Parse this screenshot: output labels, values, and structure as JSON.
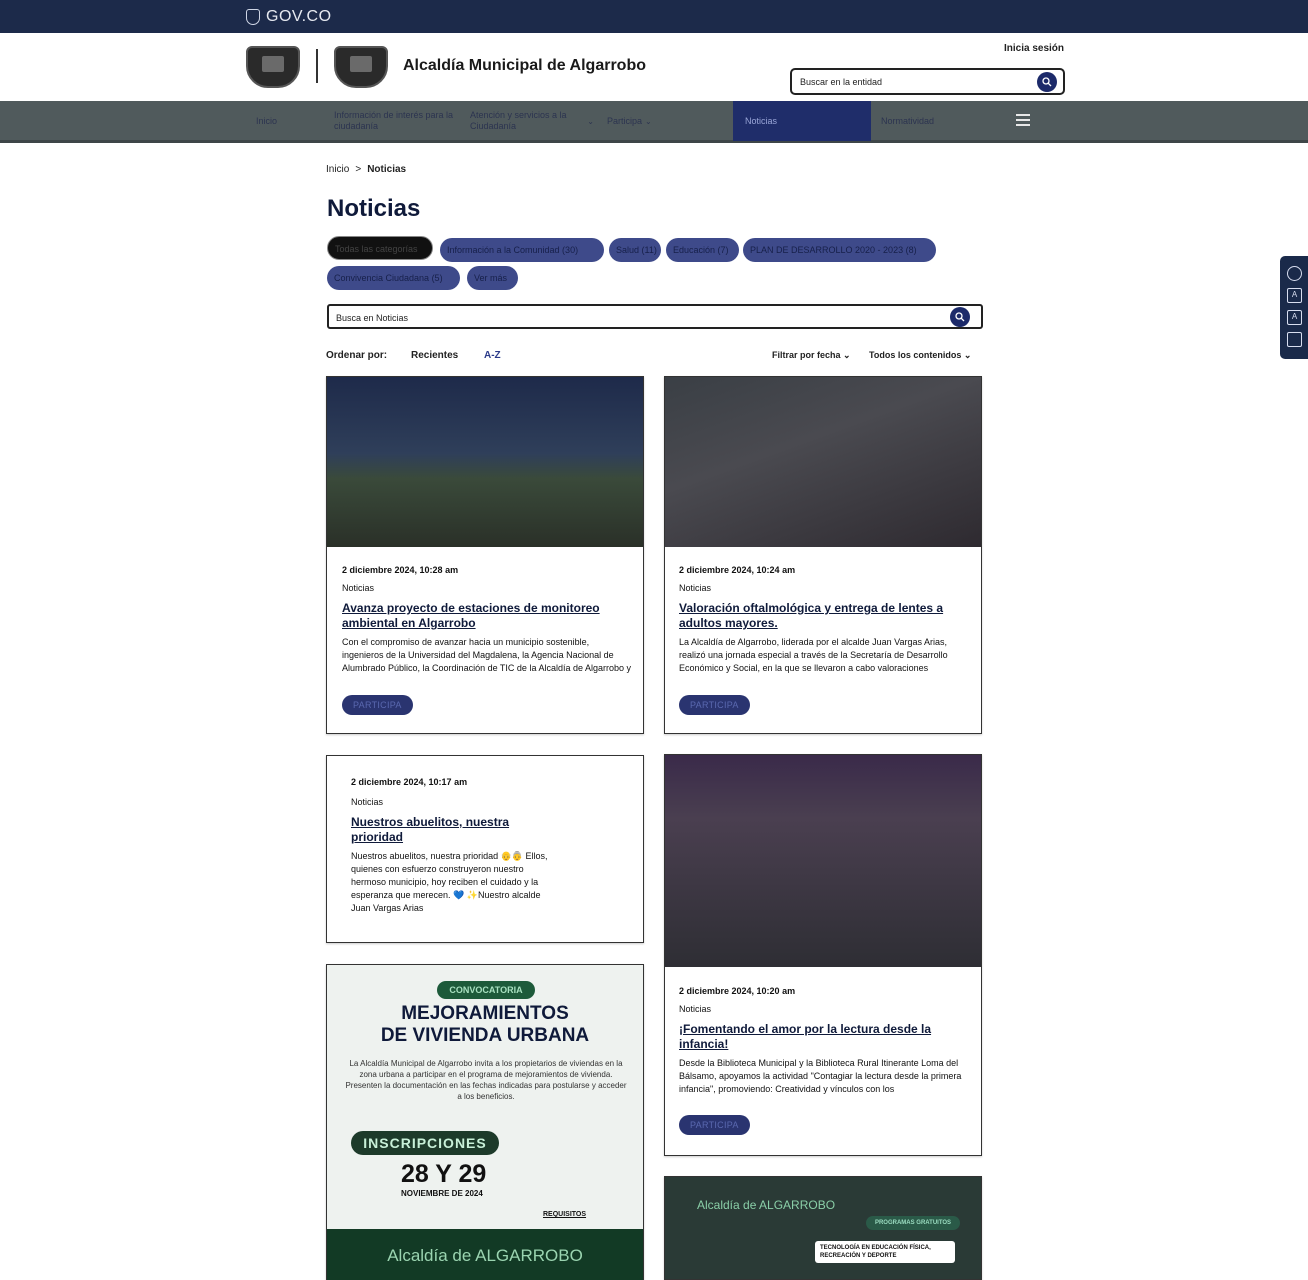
{
  "gov_bar": {
    "label": "GOV.CO"
  },
  "header": {
    "site_name": "Alcaldía Municipal de Algarrobo",
    "login": "Inicia sesión",
    "search_placeholder": "Buscar en la entidad"
  },
  "nav": {
    "items": [
      {
        "label": "Inicio"
      },
      {
        "label": "Información de interés para la ciudadanía"
      },
      {
        "label": "Atención y servicios a la Ciudadanía"
      },
      {
        "label": "Participa"
      },
      {
        "label": "Noticias"
      },
      {
        "label": "Normatividad"
      }
    ]
  },
  "breadcrumb": {
    "home": "Inicio",
    "separator": ">",
    "current": "Noticias"
  },
  "page": {
    "title": "Noticias"
  },
  "categories": [
    "Todas las categorías",
    "Información a la Comunidad (30)",
    "Salud (11)",
    "Educación (7)",
    "PLAN DE DESARROLLO 2020 - 2023 (8)",
    "Convivencia Ciudadana (5)",
    "Ver más"
  ],
  "news_search": {
    "placeholder": "Busca en Noticias"
  },
  "sort": {
    "label": "Ordenar por:",
    "recent": "Recientes",
    "az": "A-Z",
    "filter_date": "Filtrar por fecha",
    "filter_content": "Todos los contenidos"
  },
  "cards": [
    {
      "date": "2 diciembre 2024, 10:28 am",
      "category": "Noticias",
      "title": "Avanza proyecto de estaciones de monitoreo ambiental en Algarrobo",
      "summary": "Con el compromiso de avanzar hacia un municipio sostenible, ingenieros de la Universidad del Magdalena, la Agencia Nacional de Alumbrado Público, la Coordinación de TIC de la Alcaldía de Algarrobo y",
      "button": "PARTICIPA"
    },
    {
      "date": "2 diciembre 2024, 10:24 am",
      "category": "Noticias",
      "title": "Valoración oftalmológica y entrega de lentes a adultos mayores.",
      "summary": "La Alcaldía de Algarrobo, liderada por el alcalde Juan Vargas Arias, realizó una jornada especial a través de la Secretaría de Desarrollo Económico y Social, en la que se llevaron a cabo valoraciones",
      "button": "PARTICIPA"
    },
    {
      "date": "2 diciembre 2024, 10:17 am",
      "category": "Noticias",
      "title": "Nuestros abuelitos, nuestra prioridad",
      "summary": "Nuestros abuelitos, nuestra prioridad 👴👵 Ellos, quienes con esfuerzo construyeron nuestro hermoso municipio, hoy reciben el cuidado y la esperanza que merecen. 💙 ✨Nuestro alcalde Juan Vargas Arias"
    },
    {
      "date": "2 diciembre 2024, 10:20 am",
      "category": "Noticias",
      "title": "¡Fomentando el amor por la lectura desde la infancia!",
      "summary": "Desde la Biblioteca Municipal y la Biblioteca Rural Itinerante Loma del Bálsamo, apoyamos la actividad \"Contagiar la lectura desde la primera infancia\", promoviendo: Creatividad y vínculos con los",
      "button": "PARTICIPA"
    }
  ],
  "poster": {
    "tag": "CONVOCATORIA",
    "title_line1": "MEJORAMIENTOS",
    "title_line2": "DE VIVIENDA URBANA",
    "body": "La Alcaldía Municipal de Algarrobo invita a los propietarios de viviendas en la zona urbana a participar en el programa de mejoramientos de vivienda. Presenten la documentación en las fechas indicadas para postularse y acceder a los beneficios.",
    "inscriptions": "INSCRIPCIONES",
    "days": "28 Y 29",
    "month": "NOVIEMBRE DE 2024",
    "requirements": "REQUISITOS",
    "footer": "Alcaldía de ALGARROBO"
  },
  "poster2": {
    "brand": "Alcaldía de ALGARROBO",
    "badge": "PROGRAMAS GRATUITOS",
    "text": "TECNOLOGÍA EN EDUCACIÓN FÍSICA, RECREACIÓN Y DEPORTE"
  }
}
